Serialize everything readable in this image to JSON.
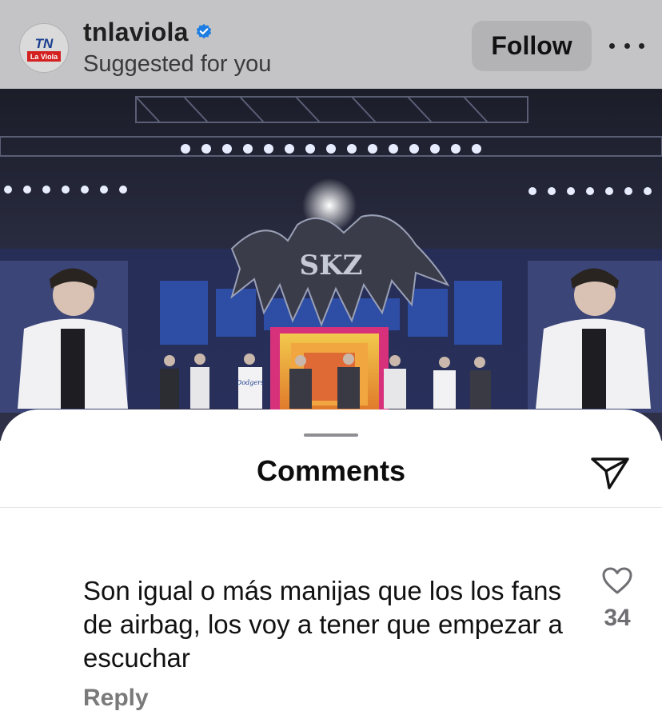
{
  "post_header": {
    "username": "tnlaviola",
    "subtitle": "Suggested for you",
    "follow_label": "Follow",
    "avatar_text_top": "TN",
    "avatar_text_bottom": "La Viola",
    "verified_icon": "verified-badge-icon",
    "more_icon": "more-horizontal-icon"
  },
  "post_image": {
    "stage_logo_text": "SKZ",
    "shirt_text": "Dodgers"
  },
  "comments_sheet": {
    "title": "Comments",
    "share_icon": "send-icon"
  },
  "comment": {
    "text": "Son igual o más manijas que los los fans de airbag, los voy a tener que empezar a escuchar",
    "reply_label": "Reply",
    "like_icon": "heart-outline-icon",
    "like_count": "34"
  },
  "colors": {
    "header_bg": "#c4c4c6",
    "verified_blue": "#1d7de3",
    "follow_bg": "#b3b3b6",
    "reply_gray": "#7a7a7a"
  }
}
